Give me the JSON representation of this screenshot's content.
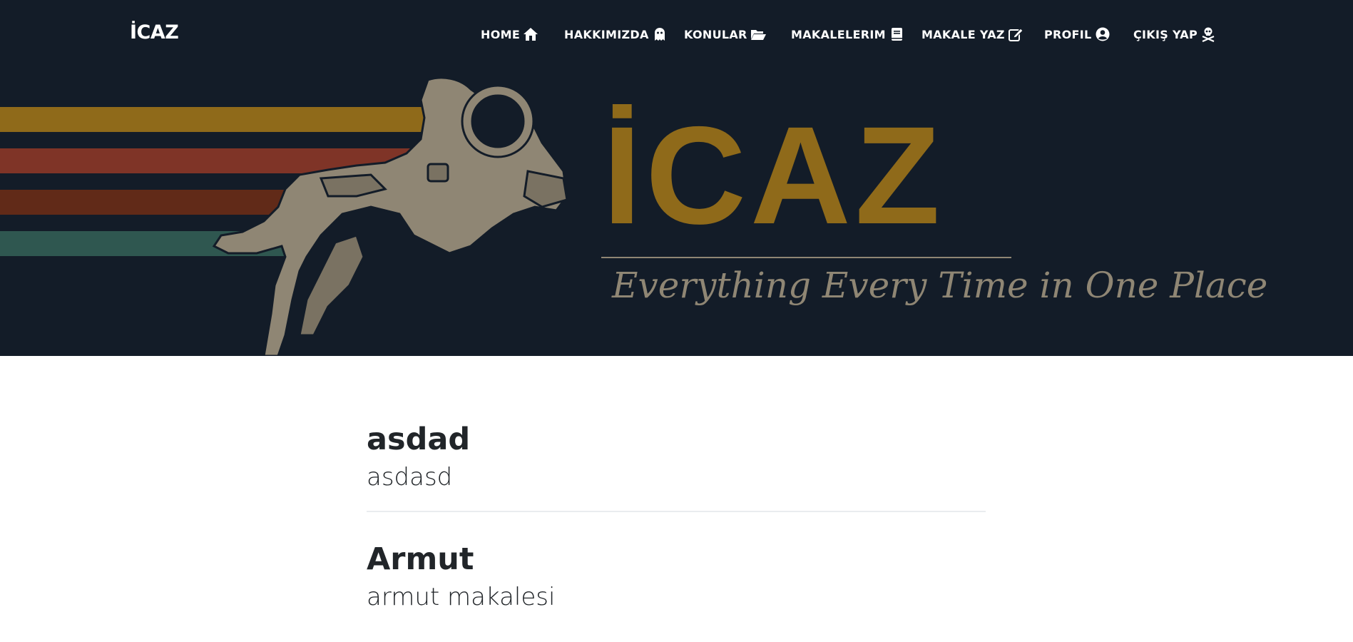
{
  "brand": "İCAZ",
  "nav": [
    {
      "label": "HOME",
      "icon": "home-icon"
    },
    {
      "label": "HAKKIMIZDA",
      "icon": "ghost-icon"
    },
    {
      "label": "KONULAR",
      "icon": "folder-open-icon"
    },
    {
      "label": "MAKALELERIM",
      "icon": "book-icon"
    },
    {
      "label": "MAKALE YAZ",
      "icon": "edit-icon"
    },
    {
      "label": "PROFIL",
      "icon": "user-circle-icon"
    },
    {
      "label": "ÇIKIŞ YAP",
      "icon": "skull-crossbones-icon"
    }
  ],
  "hero": {
    "logo_text": "İCAZ",
    "tagline": "Everything Every Time in One Place",
    "colors": {
      "background": "#131c28",
      "gold": "#8f6a1a",
      "rust": "#7f3427",
      "brown": "#612a18",
      "teal": "#2f5750",
      "tan": "#8f8674"
    }
  },
  "posts": [
    {
      "title": "asdad",
      "subtitle": "asdasd"
    },
    {
      "title": "Armut",
      "subtitle": "armut makalesi"
    }
  ]
}
